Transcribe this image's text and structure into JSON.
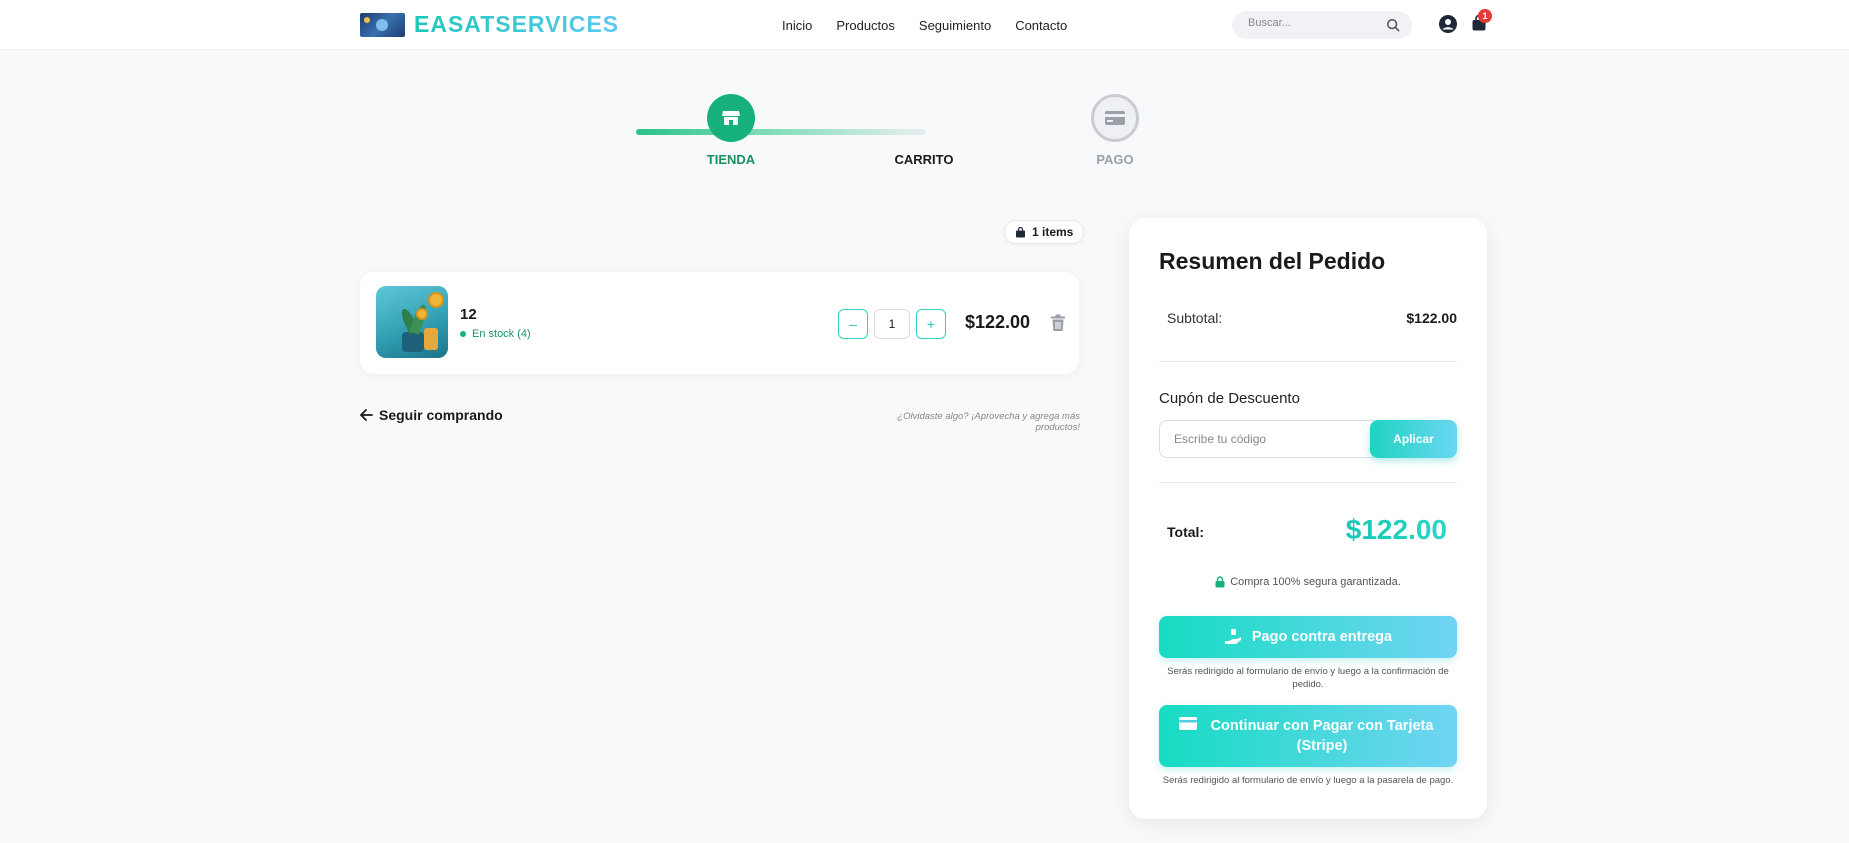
{
  "header": {
    "brand": "EASATSERVICES",
    "nav": [
      "Inicio",
      "Productos",
      "Seguimiento",
      "Contacto"
    ],
    "search_placeholder": "Buscar...",
    "cart_count": "1"
  },
  "stepper": {
    "steps": [
      "TIENDA",
      "CARRITO",
      "PAGO"
    ]
  },
  "cart": {
    "items_count": "1 items",
    "items": [
      {
        "name": "12",
        "stock": "En stock (4)",
        "quantity": "1",
        "price": "$122.00"
      }
    ],
    "continue_label": "Seguir comprando",
    "forgot_text": "¿Olvidaste algo? ¡Aprovecha y agrega más productos!"
  },
  "summary": {
    "title": "Resumen del Pedido",
    "subtotal_label": "Subtotal:",
    "subtotal_value": "$122.00",
    "coupon_label": "Cupón de Descuento",
    "coupon_placeholder": "Escribe tu código",
    "apply_label": "Aplicar",
    "total_label": "Total:",
    "total_value": "$122.00",
    "secure_text": "Compra 100% segura garantizada.",
    "cod_label": "Pago contra entrega",
    "cod_note": "Serás redirigido al formulario de envío y luego a la confirmación de pedido.",
    "card_label": "Continuar con Pagar con Tarjeta (Stripe)",
    "card_note": "Serás redirigido al formulario de envío y luego a la pasarela de pago."
  },
  "colors": {
    "accent": "#1ec8b8",
    "success": "#16b07a",
    "badge": "#e53935"
  }
}
